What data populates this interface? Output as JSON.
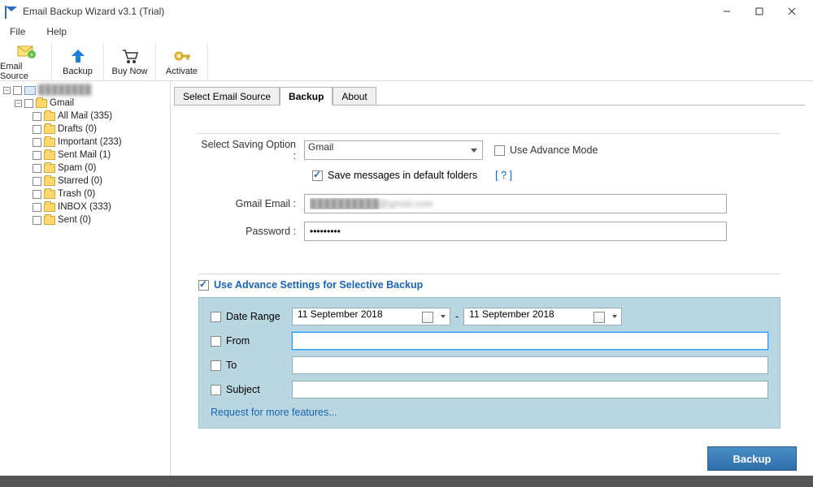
{
  "title": "Email Backup Wizard v3.1 (Trial)",
  "menu": {
    "file": "File",
    "help": "Help"
  },
  "toolbar": {
    "email_source": "Email Source",
    "backup": "Backup",
    "buy_now": "Buy Now",
    "activate": "Activate"
  },
  "tree": {
    "root_label": "████████",
    "gmail_label": "Gmail",
    "folders": [
      {
        "name": "All Mail (335)"
      },
      {
        "name": "Drafts (0)"
      },
      {
        "name": "Important (233)"
      },
      {
        "name": "Sent Mail (1)"
      },
      {
        "name": "Spam (0)"
      },
      {
        "name": "Starred (0)"
      },
      {
        "name": "Trash (0)"
      },
      {
        "name": "INBOX (333)"
      },
      {
        "name": "Sent (0)"
      }
    ]
  },
  "tabs": {
    "select_source": "Select Email Source",
    "backup": "Backup",
    "about": "About"
  },
  "form": {
    "saving_option_label": "Select Saving Option :",
    "saving_option_value": "Gmail",
    "use_advance_mode": "Use Advance Mode",
    "save_default": "Save messages in default folders",
    "help_q": "[ ? ]",
    "email_label": "Gmail Email :",
    "email_value": "██████████@gmail.com",
    "password_label": "Password :",
    "password_value": "•••••••••"
  },
  "advance": {
    "header": "Use Advance Settings for Selective Backup",
    "date_range": "Date Range",
    "date_from": "11 September 2018",
    "date_to": "11 September 2018",
    "dash": "-",
    "from": "From",
    "to": "To",
    "subject": "Subject",
    "from_value": "",
    "to_value": "",
    "subject_value": "",
    "request": "Request for more features..."
  },
  "backup_button": "Backup"
}
